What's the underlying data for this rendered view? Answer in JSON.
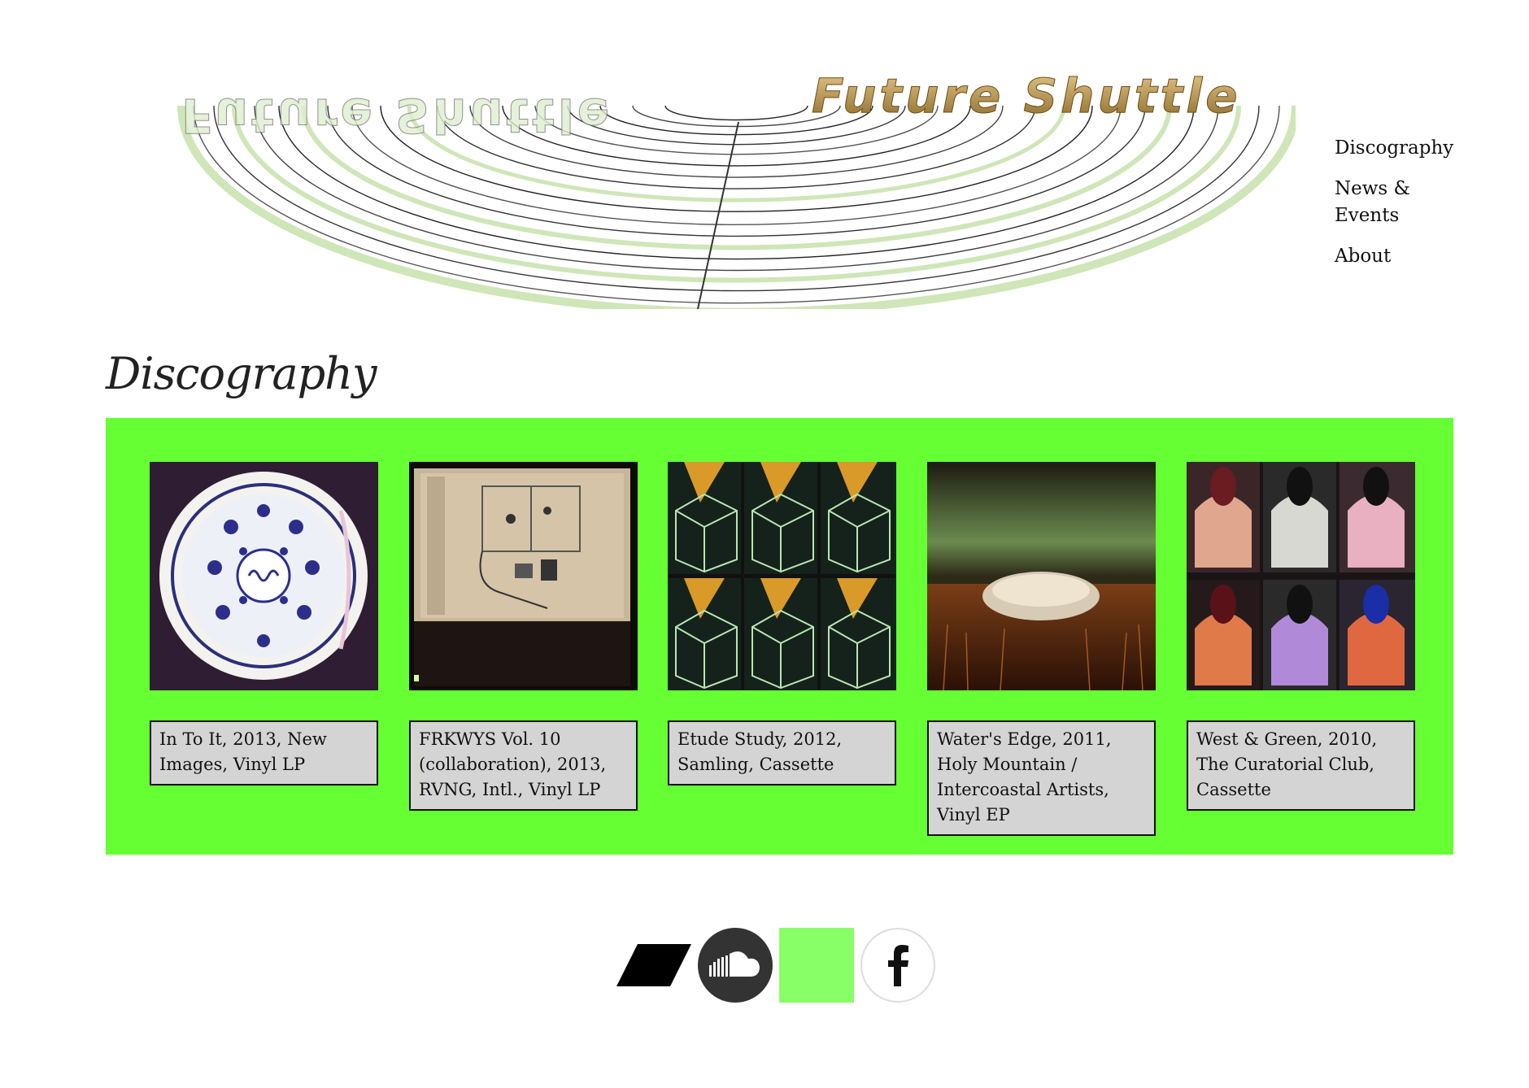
{
  "site": {
    "name": "Future Shuttle"
  },
  "nav": {
    "items": [
      {
        "label": "Discography"
      },
      {
        "label": "News & Events"
      },
      {
        "label": "About"
      }
    ]
  },
  "page": {
    "title": "Discography"
  },
  "releases": [
    {
      "caption": "In To It, 2013, New Images, Vinyl LP"
    },
    {
      "caption": "FRKWYS Vol. 10 (collaboration), 2013, RVNG, Intl., Vinyl LP"
    },
    {
      "caption": "Etude Study, 2012, Samling, Cassette"
    },
    {
      "caption": "Water's Edge, 2011, Holy Mountain / Intercoastal Artists, Vinyl EP"
    },
    {
      "caption": "West & Green, 2010, The Curatorial Club, Cassette"
    }
  ],
  "social": [
    {
      "icon": "bandcamp-icon"
    },
    {
      "icon": "soundcloud-icon"
    },
    {
      "icon": "green-square-icon"
    },
    {
      "icon": "facebook-icon"
    }
  ],
  "colors": {
    "grid_bg": "#66ff33",
    "caption_bg": "#d4d4d4",
    "accent": "#88ff66"
  }
}
